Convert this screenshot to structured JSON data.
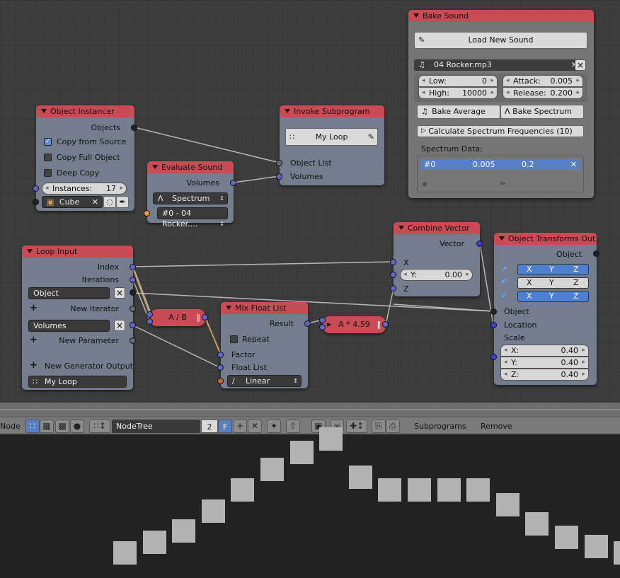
{
  "toolbar": {
    "editor_label": "Node",
    "tree_name": "NodeTree",
    "users": "2",
    "fake_user": "F",
    "subprograms_label": "Subprograms",
    "remove_label": "Remove"
  },
  "nodes": {
    "object_instancer": {
      "title": "Object Instancer",
      "objects_out": "Objects",
      "copy_from_source": "Copy from Source",
      "copy_full_object": "Copy Full Object",
      "deep_copy": "Deep Copy",
      "instances_label": "Instances:",
      "instances_value": "17",
      "object_name": "Cube",
      "copy_from_source_checked": true
    },
    "evaluate_sound": {
      "title": "Evaluate Sound",
      "volumes_out": "Volumes",
      "type": "Spectrum",
      "sound": "#0 - 04 Rocker...."
    },
    "invoke_subprogram": {
      "title": "Invoke Subprogram",
      "subprogram": "My Loop",
      "object_list": "Object List",
      "volumes": "Volumes"
    },
    "loop_input": {
      "title": "Loop Input",
      "index": "Index",
      "iterations": "Iterations",
      "param1": "Object",
      "new_iterator": "New Iterator",
      "param2": "Volumes",
      "new_parameter": "New Parameter",
      "new_generator_output": "New Generator Output",
      "loop_name": "My Loop"
    },
    "divide": {
      "label": "A / B"
    },
    "mix_float_list": {
      "title": "Mix Float List",
      "result": "Result",
      "repeat": "Repeat",
      "factor": "Factor",
      "float_list": "Float List",
      "interpolation": "Linear"
    },
    "multiply": {
      "label": "A * 4.59"
    },
    "combine_vector": {
      "title": "Combine Vector",
      "vector": "Vector",
      "x": "X",
      "y_label": "Y:",
      "y_value": "0.00",
      "z": "Z"
    },
    "object_transforms_output": {
      "title": "Object Transforms Out...",
      "object_out": "Object",
      "axes": [
        "X",
        "Y",
        "Z"
      ],
      "object_in": "Object",
      "location": "Location",
      "scale": "Scale",
      "scale_x_label": "X:",
      "scale_x": "0.40",
      "scale_y_label": "Y:",
      "scale_y": "0.40",
      "scale_z_label": "Z:",
      "scale_z": "0.40"
    }
  },
  "bake_sound": {
    "title": "Bake Sound",
    "load_new_sound": "Load New Sound",
    "sound_file": "04 Rocker.mp3",
    "low_label": "Low:",
    "low": "0",
    "high_label": "High:",
    "high": "10000",
    "attack_label": "Attack:",
    "attack": "0.005",
    "release_label": "Release:",
    "release": "0.200",
    "bake_average": "Bake Average",
    "bake_spectrum": "Bake Spectrum",
    "calculate_spectrum": "Calculate Spectrum Frequencies (10)",
    "spectrum_data_label": "Spectrum Data:",
    "spectrum_rows": [
      {
        "index": "#0",
        "low": "0.005",
        "high": "0.2"
      }
    ]
  },
  "viewport": {
    "instance_heights": [
      0.0,
      0.08,
      0.17,
      0.32,
      0.48,
      0.64,
      0.77,
      0.87,
      0.58,
      0.48,
      0.48,
      0.48,
      0.48,
      0.37,
      0.22,
      0.12,
      0.05,
      0.0
    ]
  },
  "colors": {
    "node_header": "#c94b55",
    "node_body": "#737d8d",
    "socket_float": "#6565c7",
    "socket_object": "#222222",
    "selection": "#5680c2",
    "viewport_bg": "#222222",
    "instance_color": "#b3b3b3"
  }
}
